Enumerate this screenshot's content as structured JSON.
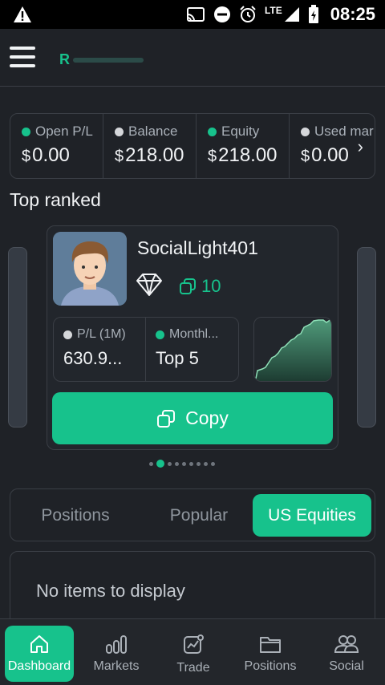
{
  "status_bar": {
    "time": "08:25",
    "network": "LTE"
  },
  "summary": {
    "stats": [
      {
        "label": "Open P/L",
        "currency": "$",
        "value": "0.00",
        "dot": "green"
      },
      {
        "label": "Balance",
        "currency": "$",
        "value": "218.00",
        "dot": "grey"
      },
      {
        "label": "Equity",
        "currency": "$",
        "value": "218.00",
        "dot": "green"
      },
      {
        "label": "Used mar",
        "currency": "$",
        "value": "0.00",
        "dot": "grey"
      }
    ]
  },
  "top_ranked": {
    "title": "Top ranked",
    "trader": {
      "name": "SocialLight401",
      "copies": "10",
      "metrics": [
        {
          "label": "P/L (1M)",
          "value": "630.9...",
          "dot": "grey"
        },
        {
          "label": "Monthl...",
          "value": "Top 5",
          "dot": "green"
        }
      ],
      "copy_label": "Copy"
    },
    "pagination": {
      "count": 9,
      "active": 1
    }
  },
  "tabs": [
    {
      "label": "Positions",
      "active": false
    },
    {
      "label": "Popular",
      "active": false
    },
    {
      "label": "US Equities",
      "active": true
    }
  ],
  "empty_message": "No items to display",
  "bottom_nav": [
    {
      "label": "Dashboard",
      "icon": "home-icon",
      "active": true
    },
    {
      "label": "Markets",
      "icon": "bars-icon",
      "active": false
    },
    {
      "label": "Trade",
      "icon": "chart-trend-icon",
      "active": false
    },
    {
      "label": "Positions",
      "icon": "folder-icon",
      "active": false
    },
    {
      "label": "Social",
      "icon": "users-icon",
      "active": false
    }
  ],
  "colors": {
    "accent": "#17c28c",
    "background": "#1f2227",
    "border": "#3a3e45"
  }
}
